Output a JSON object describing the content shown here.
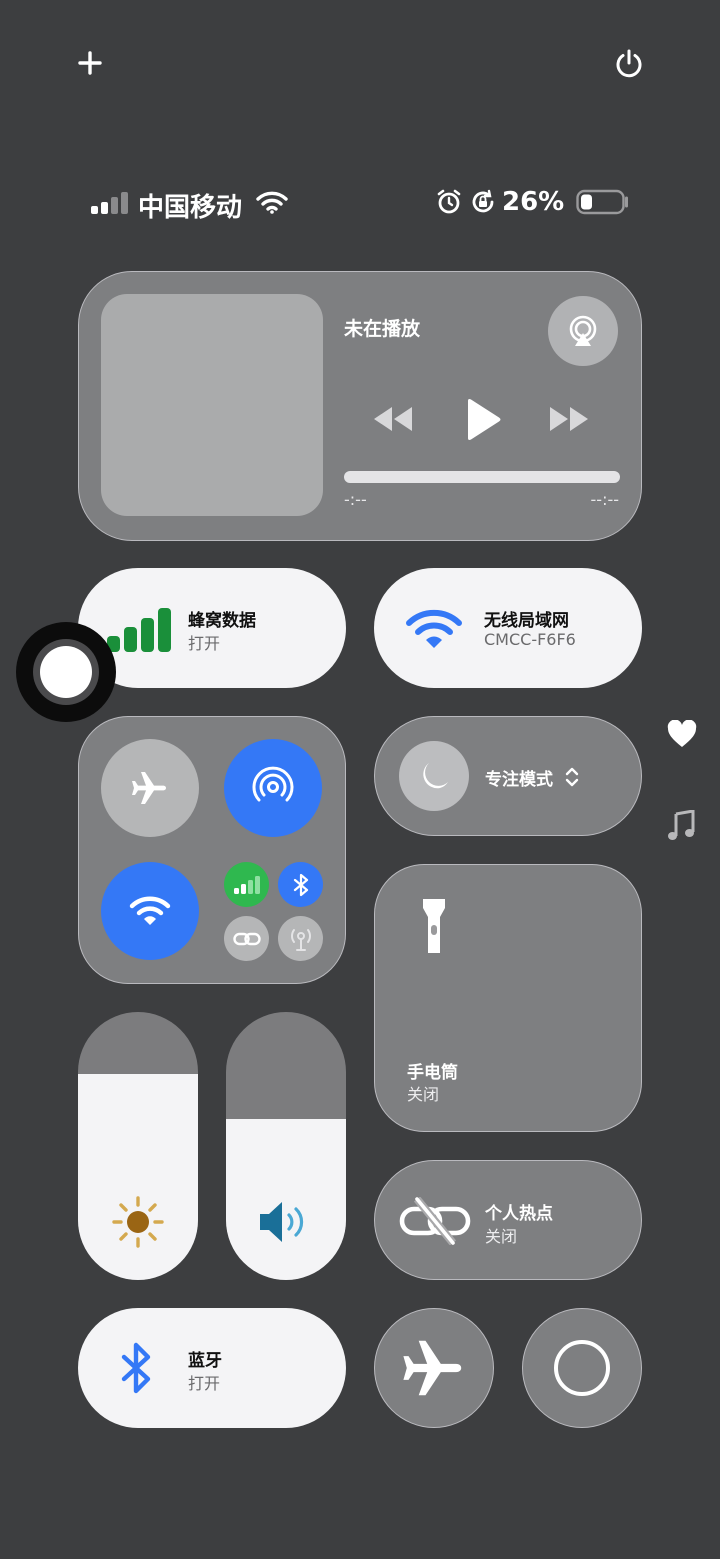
{
  "top": {
    "add_icon": "plus-icon",
    "power_icon": "power-icon"
  },
  "status": {
    "carrier": "中国移动",
    "battery_percent": "26%",
    "battery_level": 0.26,
    "cell_signal_bars": 2,
    "icons": [
      "wifi-icon",
      "alarm-icon",
      "orientation-lock-icon",
      "battery-icon"
    ]
  },
  "media": {
    "title": "未在播放",
    "time_elapsed": "-:--",
    "time_remaining": "--:--",
    "progress": 0
  },
  "cellular": {
    "title": "蜂窝数据",
    "subtitle": "打开"
  },
  "wifi": {
    "title": "无线局域网",
    "subtitle": "CMCC-F6F6"
  },
  "focus": {
    "label": "专注模式"
  },
  "flashlight": {
    "title": "手电筒",
    "subtitle": "关闭"
  },
  "hotspot": {
    "title": "个人热点",
    "subtitle": "关闭"
  },
  "bluetooth": {
    "title": "蓝牙",
    "subtitle": "打开"
  },
  "sliders": {
    "brightness_level": 0.77,
    "volume_level": 0.6
  },
  "colors": {
    "accent_blue": "#3478f6",
    "cell_green": "#1a8f3a",
    "tile_glass": "#a8a8aa",
    "background": "#3d3e40"
  }
}
